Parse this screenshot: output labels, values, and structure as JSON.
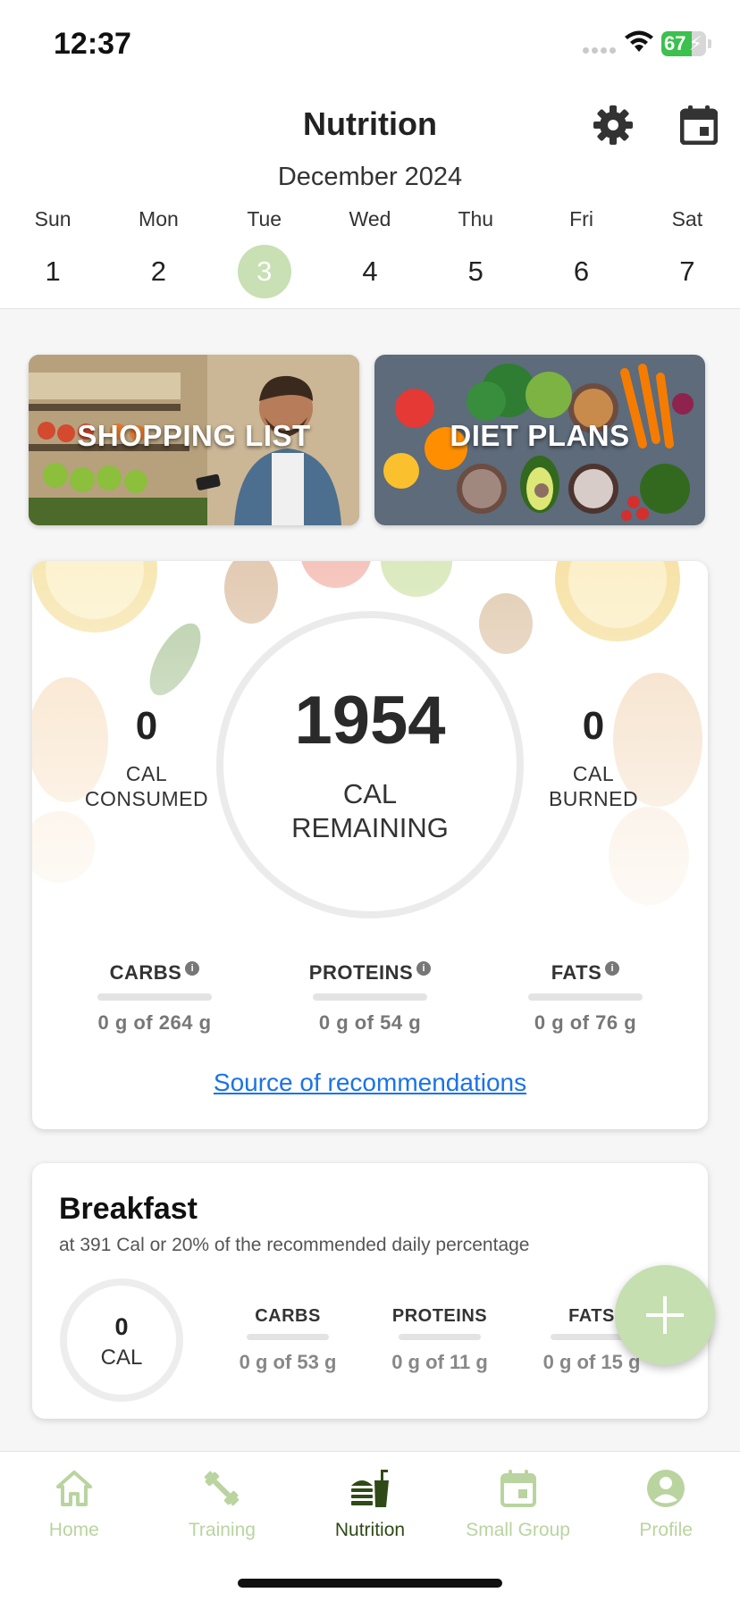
{
  "status_bar": {
    "time": "12:37",
    "battery_text": "67",
    "battery_level_percent": 67
  },
  "header": {
    "title": "Nutrition",
    "settings_icon": "gear-icon",
    "calendar_icon": "calendar-icon",
    "month": "December 2024",
    "days": [
      {
        "name": "Sun",
        "num": "1"
      },
      {
        "name": "Mon",
        "num": "2"
      },
      {
        "name": "Tue",
        "num": "3",
        "selected": true
      },
      {
        "name": "Wed",
        "num": "4"
      },
      {
        "name": "Thu",
        "num": "5"
      },
      {
        "name": "Fri",
        "num": "6"
      },
      {
        "name": "Sat",
        "num": "7"
      }
    ]
  },
  "banners": {
    "shopping": "SHOPPING LIST",
    "diet": "DIET PLANS"
  },
  "summary": {
    "remaining_value": "1954",
    "remaining_label_1": "CAL",
    "remaining_label_2": "REMAINING",
    "consumed_value": "0",
    "consumed_label_1": "CAL",
    "consumed_label_2": "CONSUMED",
    "burned_value": "0",
    "burned_label_1": "CAL",
    "burned_label_2": "BURNED",
    "macros": [
      {
        "label": "CARBS",
        "value": "0 g of 264 g"
      },
      {
        "label": "PROTEINS",
        "value": "0 g of 54 g"
      },
      {
        "label": "FATS",
        "value": "0 g of 76 g"
      }
    ],
    "info_glyph": "i",
    "source_link": "Source of recommendations"
  },
  "breakfast": {
    "title": "Breakfast",
    "subtitle": "at 391 Cal or 20% of the recommended daily percentage",
    "cal_value": "0",
    "cal_label": "CAL",
    "macros": [
      {
        "label": "CARBS",
        "value": "0 g of 53 g"
      },
      {
        "label": "PROTEINS",
        "value": "0 g of 11 g"
      },
      {
        "label": "FATS",
        "value": "0 g of 15 g"
      }
    ]
  },
  "fab": {
    "icon": "plus-icon"
  },
  "tabs": [
    {
      "label": "Home",
      "icon": "home-icon"
    },
    {
      "label": "Training",
      "icon": "dumbbell-icon"
    },
    {
      "label": "Nutrition",
      "icon": "food-icon",
      "active": true
    },
    {
      "label": "Small Group",
      "icon": "calendar-icon"
    },
    {
      "label": "Profile",
      "icon": "profile-icon"
    }
  ],
  "colors": {
    "accent_green": "#c5dfb0",
    "active_tab": "#2f4a16",
    "inactive_tab": "#b9d49f",
    "link_blue": "#1a73e8"
  }
}
